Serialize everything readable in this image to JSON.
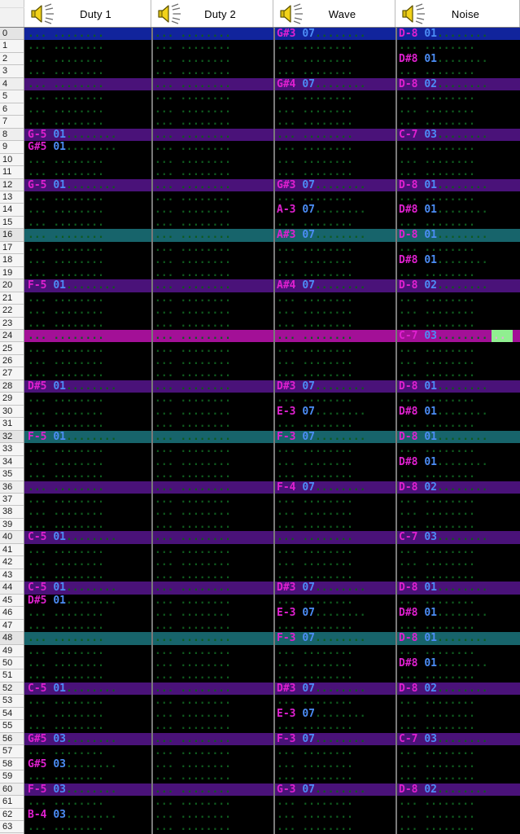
{
  "app": {
    "title": "Tracker Pattern Editor",
    "icon": "speaker-icon"
  },
  "colors": {
    "background": "#000000",
    "row_highlight_4": "#4a1279",
    "row_highlight_16": "#17646b",
    "row_playing": "#11249c",
    "row_selected": "#a31097",
    "note_text": "#e020d0",
    "instrument_text": "#4c8df6",
    "empty_dot": "#0f5c1e",
    "cursor": "#90ef90",
    "header_bg": "#ffffff",
    "rownum_bg": "#f3f3f3"
  },
  "channels": [
    {
      "id": "duty1",
      "label": "Duty 1",
      "icon": "speaker-icon",
      "muted": false
    },
    {
      "id": "duty2",
      "label": "Duty 2",
      "icon": "speaker-icon",
      "muted": false
    },
    {
      "id": "wave",
      "label": "Wave",
      "icon": "speaker-icon",
      "muted": false
    },
    {
      "id": "noise",
      "label": "Noise",
      "icon": "speaker-icon",
      "muted": false
    }
  ],
  "pattern": {
    "rows_visible": 64,
    "first_row": 0,
    "last_row": 63,
    "playing_row": 0,
    "selected_row": 24,
    "cursor": {
      "row": 24,
      "channel": "noise",
      "field": "effect-param",
      "chars": 2
    },
    "empty_note": "...",
    "empty_fx": "........"
  },
  "rows": [
    {
      "n": "0",
      "cells": [
        "",
        "",
        {
          "note": "G#3",
          "inst": "07"
        },
        {
          "note": "D-8",
          "inst": "01"
        }
      ]
    },
    {
      "n": "1",
      "cells": [
        "",
        "",
        "",
        ""
      ]
    },
    {
      "n": "2",
      "cells": [
        "",
        "",
        "",
        {
          "note": "D#8",
          "inst": "01"
        }
      ]
    },
    {
      "n": "3",
      "cells": [
        "",
        "",
        "",
        ""
      ]
    },
    {
      "n": "4",
      "cells": [
        "",
        "",
        {
          "note": "G#4",
          "inst": "07"
        },
        {
          "note": "D-8",
          "inst": "02"
        }
      ]
    },
    {
      "n": "5",
      "cells": [
        "",
        "",
        "",
        ""
      ]
    },
    {
      "n": "6",
      "cells": [
        "",
        "",
        "",
        ""
      ]
    },
    {
      "n": "7",
      "cells": [
        "",
        "",
        "",
        ""
      ]
    },
    {
      "n": "8",
      "cells": [
        {
          "note": "G-5",
          "inst": "01"
        },
        "",
        "",
        {
          "note": "C-7",
          "inst": "03"
        }
      ]
    },
    {
      "n": "9",
      "cells": [
        {
          "note": "G#5",
          "inst": "01"
        },
        "",
        "",
        ""
      ]
    },
    {
      "n": "10",
      "cells": [
        "",
        "",
        "",
        ""
      ]
    },
    {
      "n": "11",
      "cells": [
        "",
        "",
        "",
        ""
      ]
    },
    {
      "n": "12",
      "cells": [
        {
          "note": "G-5",
          "inst": "01"
        },
        "",
        {
          "note": "G#3",
          "inst": "07"
        },
        {
          "note": "D-8",
          "inst": "01"
        }
      ]
    },
    {
      "n": "13",
      "cells": [
        "",
        "",
        "",
        ""
      ]
    },
    {
      "n": "14",
      "cells": [
        "",
        "",
        {
          "note": "A-3",
          "inst": "07"
        },
        {
          "note": "D#8",
          "inst": "01"
        }
      ]
    },
    {
      "n": "15",
      "cells": [
        "",
        "",
        "",
        ""
      ]
    },
    {
      "n": "16",
      "cells": [
        "",
        "",
        {
          "note": "A#3",
          "inst": "07"
        },
        {
          "note": "D-8",
          "inst": "01"
        }
      ]
    },
    {
      "n": "17",
      "cells": [
        "",
        "",
        "",
        ""
      ]
    },
    {
      "n": "18",
      "cells": [
        "",
        "",
        "",
        {
          "note": "D#8",
          "inst": "01"
        }
      ]
    },
    {
      "n": "19",
      "cells": [
        "",
        "",
        "",
        ""
      ]
    },
    {
      "n": "20",
      "cells": [
        {
          "note": "F-5",
          "inst": "01"
        },
        "",
        {
          "note": "A#4",
          "inst": "07"
        },
        {
          "note": "D-8",
          "inst": "02"
        }
      ]
    },
    {
      "n": "21",
      "cells": [
        "",
        "",
        "",
        ""
      ]
    },
    {
      "n": "22",
      "cells": [
        "",
        "",
        "",
        ""
      ]
    },
    {
      "n": "23",
      "cells": [
        "",
        "",
        "",
        ""
      ]
    },
    {
      "n": "24",
      "cells": [
        "",
        "",
        "",
        {
          "note": "C-7",
          "inst": "03"
        }
      ]
    },
    {
      "n": "25",
      "cells": [
        "",
        "",
        "",
        ""
      ]
    },
    {
      "n": "26",
      "cells": [
        "",
        "",
        "",
        ""
      ]
    },
    {
      "n": "27",
      "cells": [
        "",
        "",
        "",
        ""
      ]
    },
    {
      "n": "28",
      "cells": [
        {
          "note": "D#5",
          "inst": "01"
        },
        "",
        {
          "note": "D#3",
          "inst": "07"
        },
        {
          "note": "D-8",
          "inst": "01"
        }
      ]
    },
    {
      "n": "29",
      "cells": [
        "",
        "",
        "",
        ""
      ]
    },
    {
      "n": "30",
      "cells": [
        "",
        "",
        {
          "note": "E-3",
          "inst": "07"
        },
        {
          "note": "D#8",
          "inst": "01"
        }
      ]
    },
    {
      "n": "31",
      "cells": [
        "",
        "",
        "",
        ""
      ]
    },
    {
      "n": "32",
      "cells": [
        {
          "note": "F-5",
          "inst": "01"
        },
        "",
        {
          "note": "F-3",
          "inst": "07"
        },
        {
          "note": "D-8",
          "inst": "01"
        }
      ]
    },
    {
      "n": "33",
      "cells": [
        "",
        "",
        "",
        ""
      ]
    },
    {
      "n": "34",
      "cells": [
        "",
        "",
        "",
        {
          "note": "D#8",
          "inst": "01"
        }
      ]
    },
    {
      "n": "35",
      "cells": [
        "",
        "",
        "",
        ""
      ]
    },
    {
      "n": "36",
      "cells": [
        "",
        "",
        {
          "note": "F-4",
          "inst": "07"
        },
        {
          "note": "D-8",
          "inst": "02"
        }
      ]
    },
    {
      "n": "37",
      "cells": [
        "",
        "",
        "",
        ""
      ]
    },
    {
      "n": "38",
      "cells": [
        "",
        "",
        "",
        ""
      ]
    },
    {
      "n": "39",
      "cells": [
        "",
        "",
        "",
        ""
      ]
    },
    {
      "n": "40",
      "cells": [
        {
          "note": "C-5",
          "inst": "01"
        },
        "",
        "",
        {
          "note": "C-7",
          "inst": "03"
        }
      ]
    },
    {
      "n": "41",
      "cells": [
        "",
        "",
        "",
        ""
      ]
    },
    {
      "n": "42",
      "cells": [
        "",
        "",
        "",
        ""
      ]
    },
    {
      "n": "43",
      "cells": [
        "",
        "",
        "",
        ""
      ]
    },
    {
      "n": "44",
      "cells": [
        {
          "note": "C-5",
          "inst": "01"
        },
        "",
        {
          "note": "D#3",
          "inst": "07"
        },
        {
          "note": "D-8",
          "inst": "01"
        }
      ]
    },
    {
      "n": "45",
      "cells": [
        {
          "note": "D#5",
          "inst": "01"
        },
        "",
        "",
        ""
      ]
    },
    {
      "n": "46",
      "cells": [
        "",
        "",
        {
          "note": "E-3",
          "inst": "07"
        },
        {
          "note": "D#8",
          "inst": "01"
        }
      ]
    },
    {
      "n": "47",
      "cells": [
        "",
        "",
        "",
        ""
      ]
    },
    {
      "n": "48",
      "cells": [
        "",
        "",
        {
          "note": "F-3",
          "inst": "07"
        },
        {
          "note": "D-8",
          "inst": "01"
        }
      ]
    },
    {
      "n": "49",
      "cells": [
        "",
        "",
        "",
        ""
      ]
    },
    {
      "n": "50",
      "cells": [
        "",
        "",
        "",
        {
          "note": "D#8",
          "inst": "01"
        }
      ]
    },
    {
      "n": "51",
      "cells": [
        "",
        "",
        "",
        ""
      ]
    },
    {
      "n": "52",
      "cells": [
        {
          "note": "C-5",
          "inst": "01"
        },
        "",
        {
          "note": "D#3",
          "inst": "07"
        },
        {
          "note": "D-8",
          "inst": "02"
        }
      ]
    },
    {
      "n": "53",
      "cells": [
        "",
        "",
        "",
        ""
      ]
    },
    {
      "n": "54",
      "cells": [
        "",
        "",
        {
          "note": "E-3",
          "inst": "07"
        },
        ""
      ]
    },
    {
      "n": "55",
      "cells": [
        "",
        "",
        "",
        ""
      ]
    },
    {
      "n": "56",
      "cells": [
        {
          "note": "G#5",
          "inst": "03"
        },
        "",
        {
          "note": "F-3",
          "inst": "07"
        },
        {
          "note": "C-7",
          "inst": "03"
        }
      ]
    },
    {
      "n": "57",
      "cells": [
        "",
        "",
        "",
        ""
      ]
    },
    {
      "n": "58",
      "cells": [
        {
          "note": "G#5",
          "inst": "03"
        },
        "",
        "",
        ""
      ]
    },
    {
      "n": "59",
      "cells": [
        "",
        "",
        "",
        ""
      ]
    },
    {
      "n": "60",
      "cells": [
        {
          "note": "F-5",
          "inst": "03"
        },
        "",
        {
          "note": "G-3",
          "inst": "07"
        },
        {
          "note": "D-8",
          "inst": "02"
        }
      ]
    },
    {
      "n": "61",
      "cells": [
        "",
        "",
        "",
        ""
      ]
    },
    {
      "n": "62",
      "cells": [
        {
          "note": "B-4",
          "inst": "03"
        },
        "",
        "",
        ""
      ]
    },
    {
      "n": "63",
      "cells": [
        "",
        "",
        "",
        ""
      ]
    }
  ]
}
